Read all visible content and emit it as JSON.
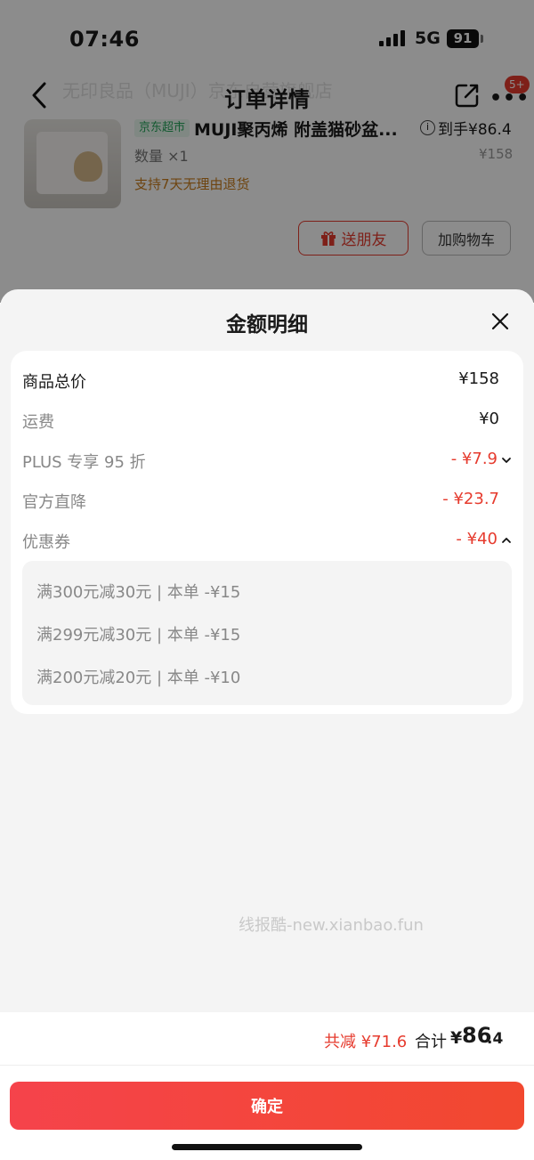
{
  "status_bar": {
    "time": "07:46",
    "network": "5G",
    "battery": "91"
  },
  "nav": {
    "title": "订单详情",
    "shop_name": "无印良品（MUJI）京东自营旗舰店",
    "badge": "5+"
  },
  "product": {
    "store_tag": "京东超市",
    "name": "MUJI聚丙烯 附盖猫砂盆...",
    "arrive_price": "到手¥86.4",
    "original_price": "¥158",
    "quantity": "数量 ×1",
    "return_policy": "支持7天无理由退货",
    "gift_button": "送朋友",
    "cart_button": "加购物车"
  },
  "sheet": {
    "title": "金额明细",
    "rows": {
      "total": {
        "label": "商品总价",
        "value": "¥158"
      },
      "shipping": {
        "label": "运费",
        "value": "¥0"
      },
      "plus": {
        "label": "PLUS 专享 95 折",
        "value": "- ¥7.9"
      },
      "official": {
        "label": "官方直降",
        "value": "- ¥23.7"
      },
      "coupon": {
        "label": "优惠券",
        "value": "- ¥40"
      }
    },
    "coupons": [
      "满300元减30元 | 本单 -¥15",
      "满299元减30元 | 本单 -¥15",
      "满200元减20元 | 本单 -¥10"
    ],
    "watermark": "线报酷-new.xianbao.fun"
  },
  "footer": {
    "saved": "共减 ¥71.6",
    "total_label": "合计",
    "total_yen": "¥",
    "total_int": "86",
    "total_dec": ".4",
    "confirm": "确定"
  },
  "colors": {
    "accent": "#e63b2e",
    "sheet_bg": "#f4f4f4"
  }
}
